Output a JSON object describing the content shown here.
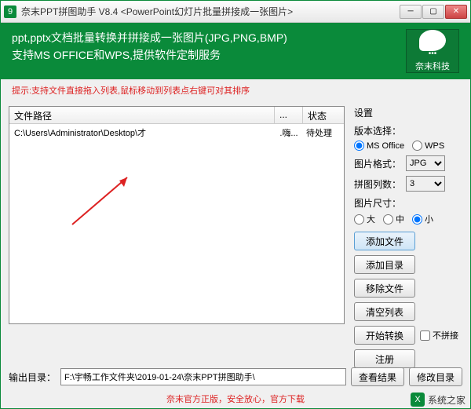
{
  "titlebar": {
    "title": "奈末PPT拼图助手 V8.4 <PowerPoint幻灯片批量拼接成一张图片>"
  },
  "header": {
    "line1": "ppt,pptx文档批量转换并拼接成一张图片(JPG,PNG,BMP)",
    "line2": "支持MS OFFICE和WPS,提供软件定制服务",
    "logo_text": "奈末科技"
  },
  "tip": "提示:支持文件直接拖入列表,鼠标移动到列表点右键可对其排序",
  "table": {
    "col_path": "文件路径",
    "col_mid": "...",
    "col_status": "状态",
    "rows": [
      {
        "path": "C:\\Users\\Administrator\\Desktop\\才",
        "mid": ".嗨...",
        "status": "待处理"
      }
    ]
  },
  "settings": {
    "title": "设置",
    "version_label": "版本选择：",
    "version_ms": "MS Office",
    "version_wps": "WPS",
    "format_label": "图片格式：",
    "format_value": "JPG",
    "cols_label": "拼图列数：",
    "cols_value": "3",
    "size_label": "图片尺寸：",
    "size_large": "大",
    "size_mid": "中",
    "size_small": "小",
    "btn_addfile": "添加文件",
    "btn_adddir": "添加目录",
    "btn_remove": "移除文件",
    "btn_clear": "清空列表",
    "btn_start": "开始转换",
    "chk_nopinch": "不拼接",
    "btn_register": "注册"
  },
  "bottom": {
    "outdir_label": "输出目录：",
    "outdir_value": "F:\\宇畅工作文件夹\\2019-01-24\\奈末PPT拼图助手\\",
    "btn_view": "查看结果",
    "btn_modify": "修改目录"
  },
  "footer": {
    "text": "奈末官方正版，安全放心，官方下载"
  },
  "watermark": "系统之家"
}
